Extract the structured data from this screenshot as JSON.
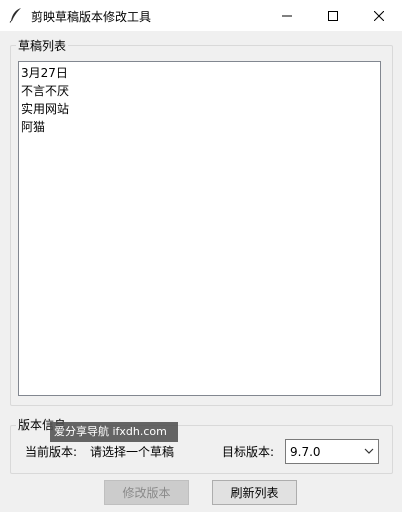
{
  "window": {
    "title": "剪映草稿版本修改工具",
    "icon": "feather-icon",
    "controls": [
      "minimize-icon",
      "maximize-icon",
      "close-icon"
    ]
  },
  "drafts": {
    "legend": "草稿列表",
    "items": [
      "3月27日",
      "不言不厌",
      "实用网站",
      "阿猫"
    ]
  },
  "version": {
    "legend": "版本信息",
    "current_label": "当前版本:",
    "current_value": "请选择一个草稿",
    "target_label": "目标版本:",
    "target_value": "9.7.0"
  },
  "watermark": "爱分享导航 ifxdh.com",
  "buttons": {
    "modify": "修改版本",
    "refresh": "刷新列表"
  }
}
